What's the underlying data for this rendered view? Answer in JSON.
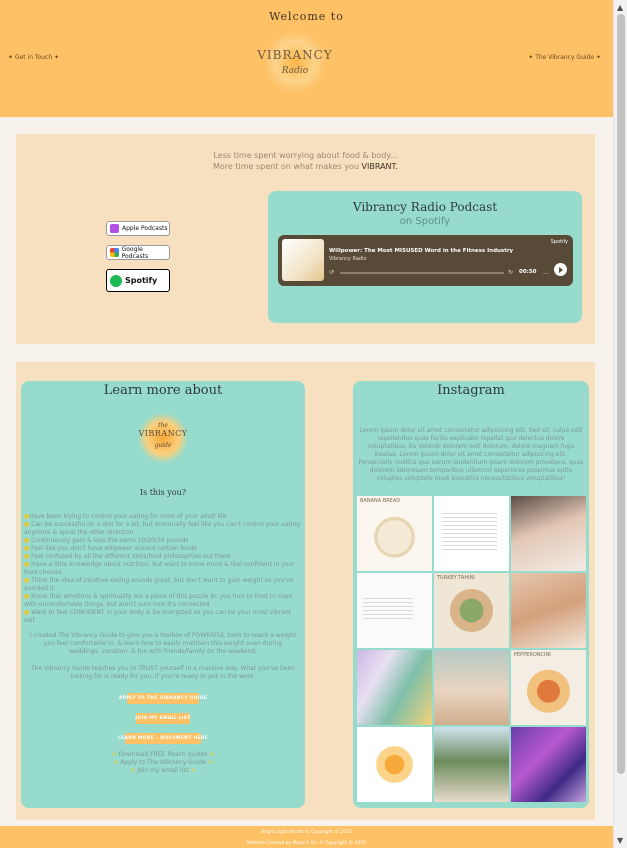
{
  "header": {
    "welcome": "Welcome to",
    "nav_left": "✦ Get in Touch ✦",
    "nav_right": "✦ The Vibrancy Guide ✦",
    "logo_word": "VIBRANCY",
    "logo_sub": "Radio"
  },
  "intro": {
    "line1": "Less time spent worrying about food & body...",
    "line2_prefix": "More time spent on what makes you ",
    "line2_emphasis": "VIBRANT."
  },
  "badges": {
    "apple": "Apple Podcasts",
    "google": "Google Podcasts",
    "spotify": "Spotify"
  },
  "podcast": {
    "title": "Vibrancy Radio Podcast",
    "subtitle": "on Spotify",
    "player": {
      "episode": "Willpower: The Most MISUSED Word in the Fitness Industry",
      "show": "Vibrancy Radio",
      "brand": "Spotify",
      "time": "00:50"
    }
  },
  "learn": {
    "title": "Learn more about",
    "guide_word": "VIBRANCY",
    "guide_sub": "guide",
    "the": "the",
    "is_this": "Is this you?",
    "bullets": [
      "Have been trying to control your eating for most of your adult life",
      "Can be successful on a diet for a bit, but eventually feel like you can't control your eating anymore & spiral the other direction",
      "Continuously gain & lose the same 10/20/30 pounds",
      "Feel like you don't have willpower around certain foods",
      "Feel confused by all the different diets/food philosophies out there",
      "Have a little knowledge about nutrition, but want to know more & feel confident in your food choices",
      "Think the idea of intuitive eating sounds great, but don't want to gain weight so you've avoided it",
      "Know that emotions & spirituality are a piece of this puzzle bc you turn to food to cope with uncomfortable things, but aren't sure how it's connected",
      "Want to feel CONFIDENT in your body & be energized so you can be your most vibrant self"
    ],
    "para1": "I created The Vibrancy Guide to give you a toolbox of POWERFUL tools to reach a weight you feel comfortable in, & learn how to easily maintain this weight even during weddings, vacation, & fun with friends/family on the weekend.",
    "para2": "The Vibrancy Guide teaches you to TRUST yourself in a massive way. What you've been looking for is ready for you, if you're ready to put in the work.",
    "btn1": "APPLY TO THE VIBRANCY GUIDE",
    "btn2": "JOIN MY EMAIL LIST",
    "btn3": "LEARN MORE – DOCUMENT HERE",
    "link1": "Download FREE Reach guides",
    "link2": "Apply to The Vibrancy Guide",
    "link3": "Join my email list"
  },
  "instagram": {
    "title": "Instagram",
    "lorem": "Lorem ipsum dolor sit amet consectetur adipisicing elit. Sed sit, culpa odit repellendus quas facilis explicabo repellat quo delectus dolore voluptatibus. Eu deleniti dolorem odit dolorum, dolore magnam fuga beatae. Lorem ipsum dolor sit amet consectetur adipisicing elit. Perspiciatis mollitia quo earum laudantium ipsam dolorem providens, quas dolorem laborosam temporibus ullamcot asperiores possimus optio voluptas voluptate modi blanditiis necessitatibus voluptatibus!",
    "tiles": [
      {
        "caption": "BANANA BREAD",
        "style": "food-cream"
      },
      {
        "caption": "",
        "style": "text-post"
      },
      {
        "caption": "",
        "style": "selfie-dark"
      },
      {
        "caption": "",
        "style": "text-post"
      },
      {
        "caption": "TURKEY TAHINI",
        "style": "bowl-green"
      },
      {
        "caption": "",
        "style": "selfie-light"
      },
      {
        "caption": "",
        "style": "products"
      },
      {
        "caption": "",
        "style": "group-beach"
      },
      {
        "caption": "PEPPERONCINI",
        "style": "bowl-orange"
      },
      {
        "caption": "",
        "style": "sun-logo"
      },
      {
        "caption": "",
        "style": "palms"
      },
      {
        "caption": "",
        "style": "purple-fabric"
      }
    ]
  },
  "footer": {
    "line1": "Bright Light Health © Copyright © 2020",
    "line2": "Website Created by Maya R Orr © Copyright © 2020"
  },
  "colors": {
    "header_bg": "#fec166",
    "section_bg": "#f7e0bf",
    "card_bg": "#97dbcc",
    "bullet_dot": "#f0c531"
  }
}
